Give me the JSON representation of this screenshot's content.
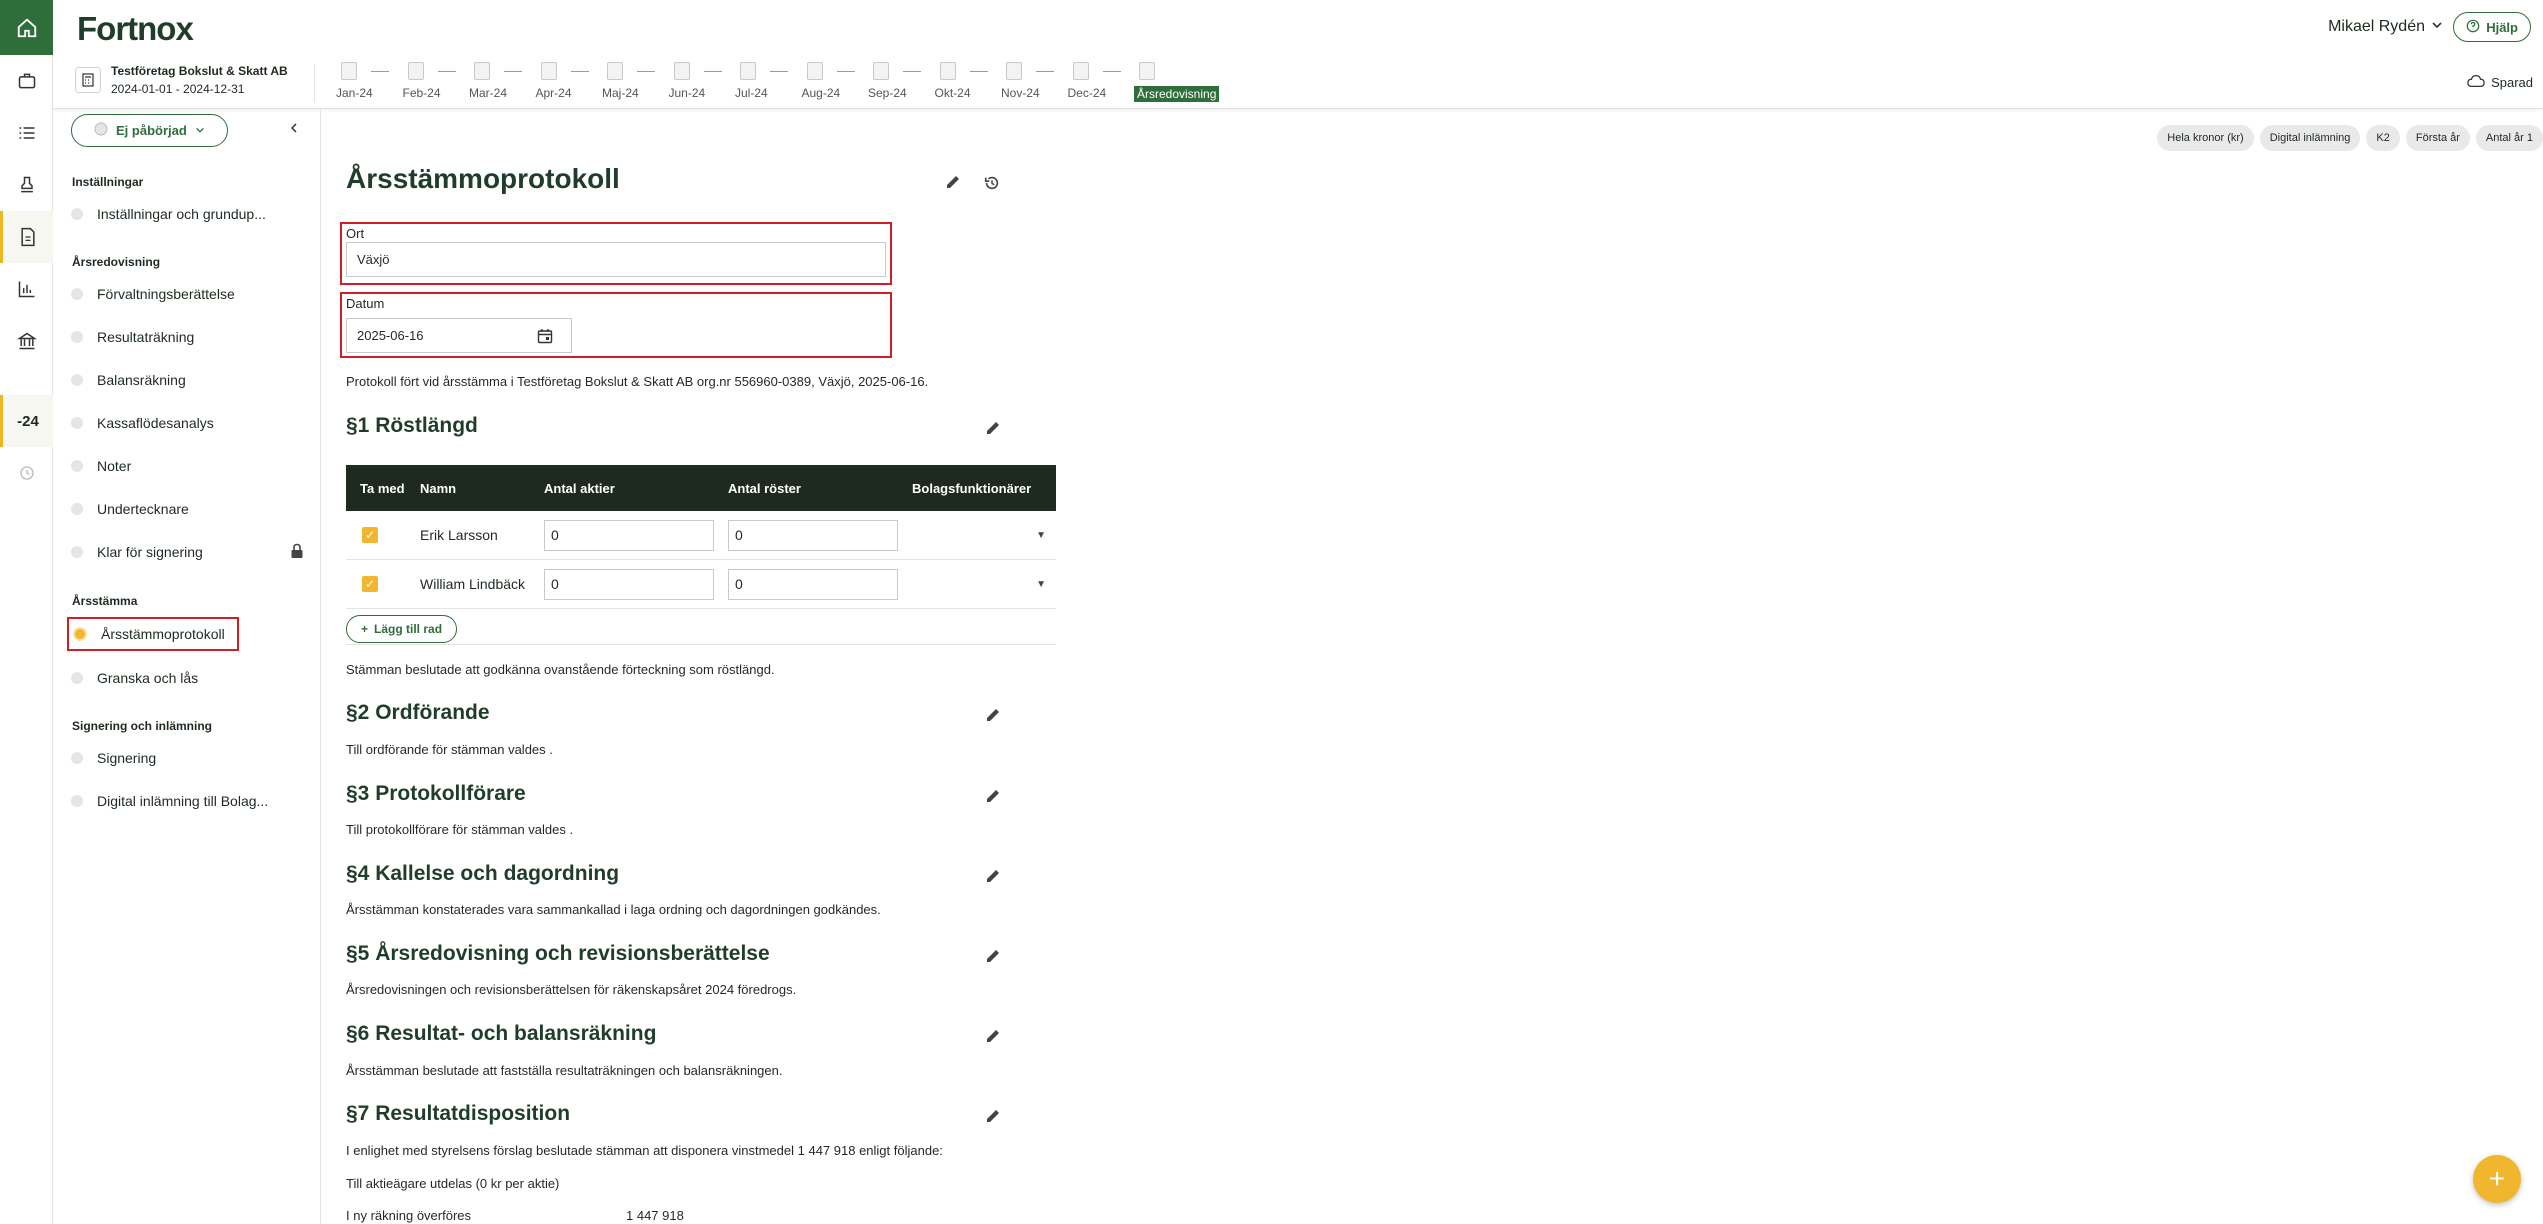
{
  "header": {
    "logo": "Fortnox",
    "user_name": "Mikael Rydén",
    "help_label": "Hjälp"
  },
  "rail": {
    "year_label": "-24"
  },
  "company": {
    "name": "Testföretag Bokslut & Skatt AB",
    "period": "2024-01-01 - 2024-12-31"
  },
  "periods": [
    "Jan-24",
    "Feb-24",
    "Mar-24",
    "Apr-24",
    "Maj-24",
    "Jun-24",
    "Jul-24",
    "Aug-24",
    "Sep-24",
    "Okt-24",
    "Nov-24",
    "Dec-24",
    "Årsredovisning"
  ],
  "saved_label": "Sparad",
  "sidebar": {
    "status": "Ej påbörjad",
    "sections": [
      {
        "title": "Inställningar",
        "items": [
          "Inställningar och grundup..."
        ]
      },
      {
        "title": "Årsredovisning",
        "items": [
          "Förvaltningsberättelse",
          "Resultaträkning",
          "Balansräkning",
          "Kassaflödesanalys",
          "Noter",
          "Undertecknare",
          "Klar för signering"
        ]
      },
      {
        "title": "Årsstämma",
        "items": [
          "Årsstämmoprotokoll",
          "Granska och lås"
        ]
      },
      {
        "title": "Signering och inlämning",
        "items": [
          "Signering",
          "Digital inlämning till Bolag..."
        ]
      }
    ]
  },
  "chips": [
    "Hela kronor (kr)",
    "Digital inlämning",
    "K2",
    "Första år",
    "Antal år 1"
  ],
  "main": {
    "title": "Årsstämmoprotokoll",
    "ort_label": "Ort",
    "ort_value": "Växjö",
    "datum_label": "Datum",
    "datum_value": "2025-06-16",
    "intro": "Protokoll fört vid årsstämma i Testföretag Bokslut & Skatt AB org.nr 556960-0389, Växjö, 2025-06-16."
  },
  "table": {
    "headers": [
      "Ta med",
      "Namn",
      "Antal aktier",
      "Antal röster",
      "Bolagsfunktionärer"
    ],
    "rows": [
      {
        "name": "Erik Larsson",
        "aktier": "0",
        "roster": "0"
      },
      {
        "name": "William Lindbäck",
        "aktier": "0",
        "roster": "0"
      }
    ],
    "add_label": "Lägg till rad"
  },
  "sections": [
    {
      "title": "§1 Röstlängd",
      "text": "Stämman beslutade att godkänna ovanstående förteckning som röstlängd."
    },
    {
      "title": "§2 Ordförande",
      "text": "Till ordförande för stämman valdes ."
    },
    {
      "title": "§3 Protokollförare",
      "text": "Till protokollförare för stämman valdes ."
    },
    {
      "title": "§4 Kallelse och dagordning",
      "text": "Årsstämman konstaterades vara sammankallad i laga ordning och dagordningen godkändes."
    },
    {
      "title": "§5 Årsredovisning och revisionsberättelse",
      "text": "Årsredovisningen och revisionsberättelsen för räkenskapsåret 2024 föredrogs."
    },
    {
      "title": "§6 Resultat- och balansräkning",
      "text": "Årsstämman beslutade att fastställa resultaträkningen och balansräkningen."
    },
    {
      "title": "§7 Resultatdisposition",
      "text": "I enlighet med styrelsens förslag beslutade stämman att disponera vinstmedel 1 447 918 enligt följande:"
    }
  ],
  "disposition": {
    "dividend": "Till aktieägare utdelas (0 kr per aktie)",
    "carry_label": "I ny räkning överföres",
    "carry_value": "1 447 918"
  }
}
